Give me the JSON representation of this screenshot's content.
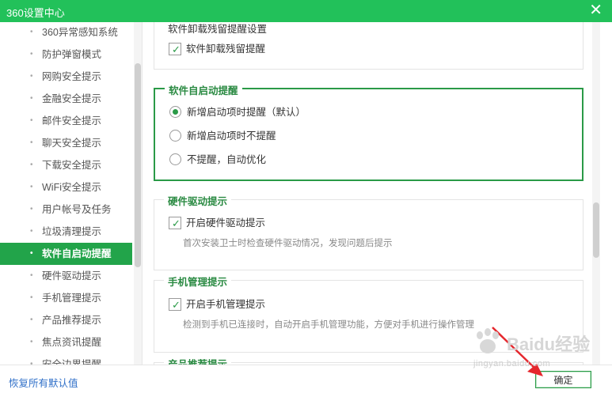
{
  "window": {
    "title": "360设置中心",
    "close_glyph": "✕"
  },
  "sidebar": {
    "items": [
      {
        "label": "360异常感知系统",
        "active": false
      },
      {
        "label": "防护弹窗模式",
        "active": false
      },
      {
        "label": "网购安全提示",
        "active": false
      },
      {
        "label": "金融安全提示",
        "active": false
      },
      {
        "label": "邮件安全提示",
        "active": false
      },
      {
        "label": "聊天安全提示",
        "active": false
      },
      {
        "label": "下载安全提示",
        "active": false
      },
      {
        "label": "WiFi安全提示",
        "active": false
      },
      {
        "label": "用户帐号及任务",
        "active": false
      },
      {
        "label": "垃圾清理提示",
        "active": false
      },
      {
        "label": "软件自启动提醒",
        "active": true
      },
      {
        "label": "硬件驱动提示",
        "active": false
      },
      {
        "label": "手机管理提示",
        "active": false
      },
      {
        "label": "产品推荐提示",
        "active": false
      },
      {
        "label": "焦点资讯提醒",
        "active": false
      },
      {
        "label": "安全边界提醒",
        "active": false
      }
    ]
  },
  "sections": {
    "uninstall": {
      "title": "软件卸载残留提醒设置",
      "checkbox_label": "软件卸载残留提醒",
      "checked": true
    },
    "autostart": {
      "title": "软件自启动提醒",
      "options": [
        {
          "label": "新增启动项时提醒（默认）",
          "selected": true
        },
        {
          "label": "新增启动项时不提醒",
          "selected": false
        },
        {
          "label": "不提醒，自动优化",
          "selected": false
        }
      ]
    },
    "hardware": {
      "title": "硬件驱动提示",
      "checkbox_label": "开启硬件驱动提示",
      "checked": true,
      "description": "首次安装卫士时检查硬件驱动情况，发现问题后提示"
    },
    "phone": {
      "title": "手机管理提示",
      "checkbox_label": "开启手机管理提示",
      "checked": true,
      "description": "检测到手机已连接时，自动开启手机管理功能，方便对手机进行操作管理"
    },
    "product": {
      "title": "产品推荐提示"
    }
  },
  "footer": {
    "restore_label": "恢复所有默认值",
    "ok_label": "确定"
  },
  "watermark": {
    "main": "Baidu经验",
    "sub": "jingyan.baidu.com"
  },
  "colors": {
    "titlebar": "#22c15a",
    "accent": "#2a9a47",
    "active_item": "#22a44a",
    "arrow": "#e5272d",
    "link": "#2f6fc8"
  }
}
